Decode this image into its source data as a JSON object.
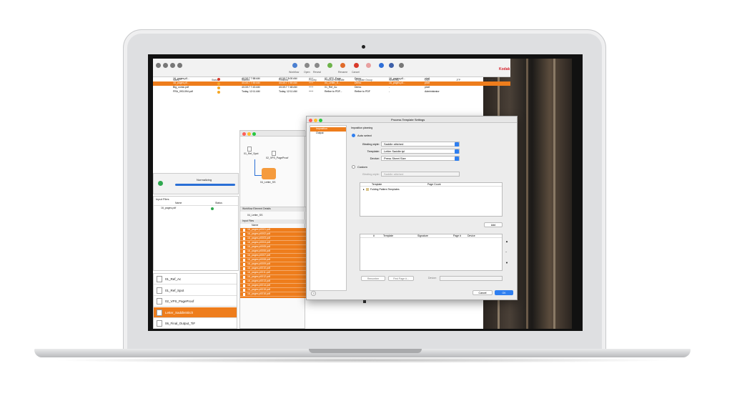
{
  "toolbar": {
    "items": [
      "Workflow",
      "Open",
      "Reveal",
      "",
      "Rename",
      "Cancel",
      "",
      "",
      "",
      ""
    ],
    "brand": "Kodak"
  },
  "jobs": {
    "headers": [
      "Name",
      "Status",
      "Started",
      "Finished",
      "Priority",
      "Process Template",
      "Template Group",
      "Workflow",
      "User",
      "JTP",
      "JTP Pool"
    ],
    "rows": [
      {
        "name": "16_pages.p0...",
        "status_color": "#d93a2b",
        "started": "4/13/17 7:58 AM",
        "finished": "4/13/17 8:00 AM",
        "priority": "+++",
        "template": "02_VPS_Page...",
        "group": "Demo",
        "workflow": "16_pages.p0...",
        "user": "pixel",
        "selected": false
      },
      {
        "name": "16_pages.p0...",
        "status_color": "#f5a623",
        "started": "4/13/17 7:59 AM",
        "finished": "4/13/17 7:59 AM",
        "priority": "+++",
        "template": "04_Letter_S...",
        "group": "Demo",
        "workflow": "16_pages.p0...",
        "user": "pixel",
        "selected": true
      },
      {
        "name": "Big_comic.pdf",
        "status_color": "#f5a623",
        "started": "4/13/17 7:43 AM",
        "finished": "4/13/17 7:48 AM",
        "priority": "+++",
        "template": "01_Ref_Ac",
        "group": "Demo",
        "workflow": "-",
        "user": "pixel",
        "selected": false
      },
      {
        "name": "FRA_093-094.pdf",
        "status_color": "#f5a623",
        "started": "Today, 12:11 AM",
        "finished": "Today, 12:11 AM",
        "priority": "+++",
        "template": "Refine to PDF...",
        "group": "Refine to PDF",
        "workflow": "-",
        "user": "Administrator",
        "selected": false
      }
    ]
  },
  "progress": {
    "label": "Normalizing"
  },
  "input_files_left": {
    "title": "Input Files",
    "headers": [
      "Name",
      "Status"
    ],
    "rows": [
      {
        "name": "16_pages.pdf"
      }
    ]
  },
  "workflow": {
    "nodes": [
      "01_Ref_Spot",
      "02_VPS_PageProof",
      "04_Letter_SS"
    ],
    "details_title": "Workflow Element Details",
    "details_item": "04_Letter_SS",
    "input_files_title": "Input Files",
    "col": "Name",
    "files": [
      "16_pages.p0001.pdf",
      "16_pages.p0002.pdf",
      "16_pages.p0003.pdf",
      "16_pages.p0004.pdf",
      "16_pages.p0005.pdf",
      "16_pages.p0006.pdf",
      "16_pages.p0007.pdf",
      "16_pages.p0008.pdf",
      "16_pages.p0009.pdf",
      "16_pages.p0010.pdf",
      "16_pages.p0011.pdf",
      "16_pages.p0012.pdf",
      "16_pages.p0013.pdf",
      "16_pages.p0014.pdf",
      "16_pages.p0015.pdf",
      "16_pages.p0016.pdf"
    ]
  },
  "templates": [
    {
      "label": "01_Ref_Ac",
      "selected": false
    },
    {
      "label": "01_Ref_Spot",
      "selected": false
    },
    {
      "label": "02_VPS_PageProof",
      "selected": false
    },
    {
      "label": "Letter_SaddleStitch",
      "selected": true
    },
    {
      "label": "06_Final_Output_TiF",
      "selected": false
    }
  ],
  "dialog": {
    "title": "Process Template Settings",
    "nav": [
      "Imposition",
      "Output"
    ],
    "section": "Imposition planning",
    "auto_select": "Auto select",
    "binding_label": "Binding style:",
    "binding_value": "Saddle stitched",
    "template_label": "Template:",
    "template_value": "Letter Saddle.tpl",
    "device_label": "Device:",
    "device_value": "Press Sheet Size",
    "custom": "Custom",
    "custom_binding_label": "Binding style:",
    "custom_binding_value": "Saddle stitched",
    "tree_headers": [
      "Template",
      "Page Count"
    ],
    "tree_item": "Folding Pattern Templates",
    "add": "Add",
    "table_headers": [
      "#",
      "Template",
      "Signature",
      "Page #",
      "Device"
    ],
    "renumber": "Renumber",
    "first_page": "First Page #...",
    "device2_label": "Device:",
    "cancel": "Cancel",
    "ok": "OK",
    "help": "?"
  }
}
